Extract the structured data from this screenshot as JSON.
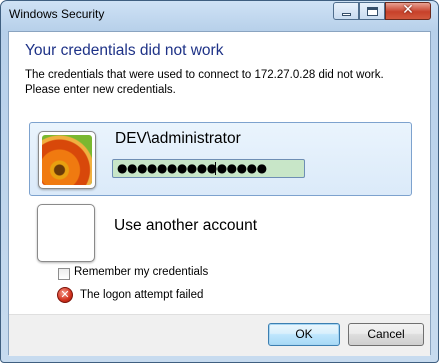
{
  "window": {
    "title": "Windows Security",
    "controls": [
      "minimize-icon",
      "maximize-icon",
      "close-icon"
    ],
    "close_glyph": "✕"
  },
  "message": {
    "heading": "Your credentials did not work",
    "description": "The credentials that were used to connect to 172.27.0.28 did not work. Please enter new credentials."
  },
  "accounts": [
    {
      "username": "DEV\\administrator",
      "password_mask": "●●●●●●●●●●●●●●●",
      "selected": true,
      "avatar": "flower-photo"
    },
    {
      "label": "Use another account",
      "selected": false,
      "avatar": "blank-tile"
    }
  ],
  "options": {
    "remember_label": "Remember my credentials",
    "remember_checked": false
  },
  "error": {
    "icon": "error-icon",
    "glyph": "✕",
    "text": "The logon attempt failed"
  },
  "buttons": {
    "ok": "OK",
    "cancel": "Cancel"
  },
  "colors": {
    "heading": "#1e3287",
    "password_bg": "#c8e6c8",
    "selection_border": "#7da2ce"
  }
}
